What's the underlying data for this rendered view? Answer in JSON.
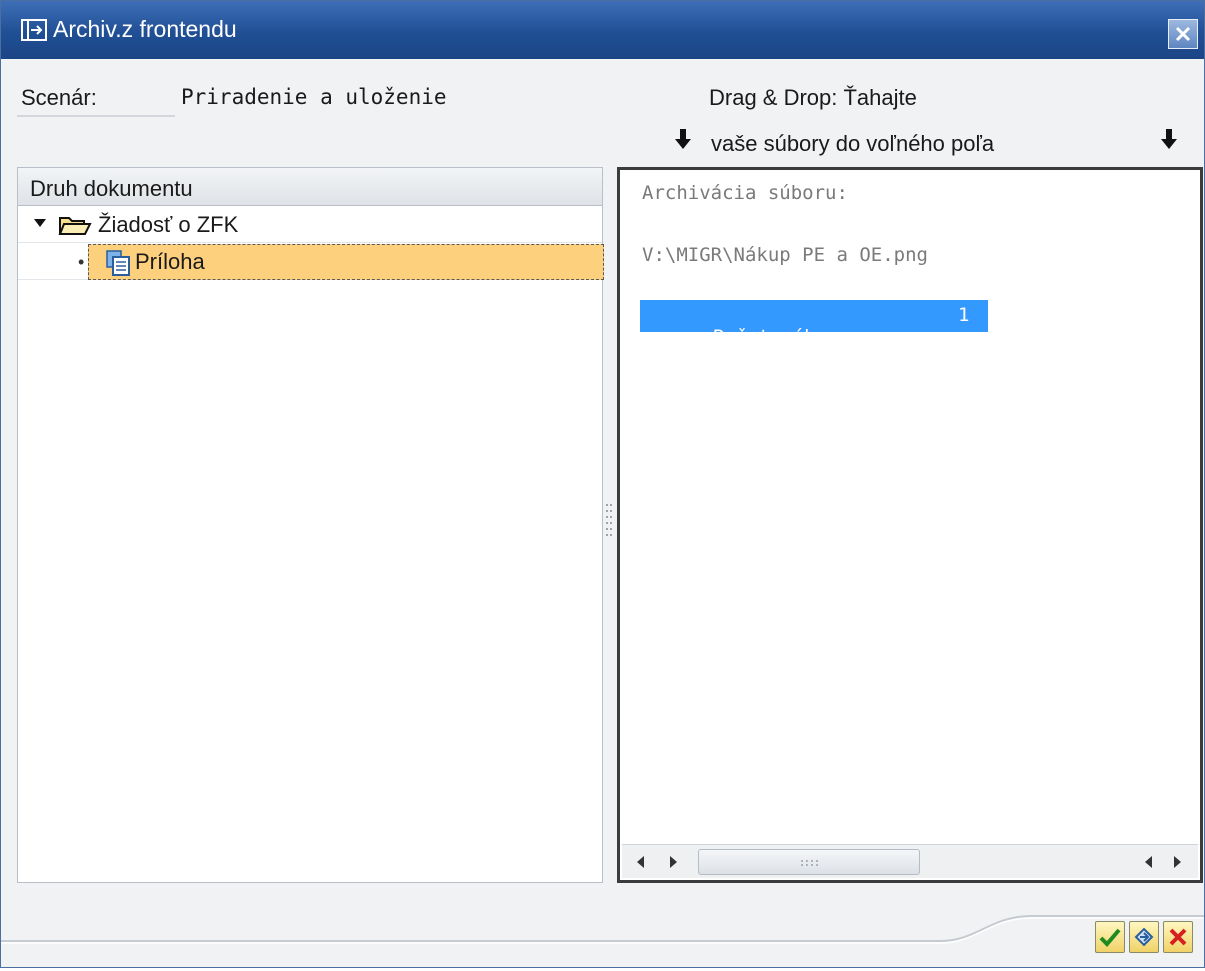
{
  "window": {
    "title": "Archiv.z frontendu",
    "title_icon": "dialog-icon",
    "close_icon": "close-icon"
  },
  "header": {
    "scenario_label": "Scenár:",
    "scenario_value": "Priradenie a uloženie",
    "dnd_line1": "Drag & Drop: Ťahajte",
    "dnd_line2": "vaše súbory do voľného poľa",
    "arrow_icon": "arrow-down-icon"
  },
  "tree": {
    "column_header": "Druh dokumentu",
    "nodes": [
      {
        "label": "Žiadosť o ZFK",
        "icon": "folder-open-icon",
        "expanded": true
      },
      {
        "label": "Príloha",
        "icon": "document-icon",
        "selected": true
      }
    ]
  },
  "log": {
    "line1": "Archivácia súboru:",
    "line2": "V:\\MIGR\\Nákup PE a OE.png",
    "count_label": "Počet súborov:",
    "count_value": "1"
  },
  "footer": {
    "buttons": [
      {
        "name": "confirm",
        "icon": "checkmark-icon"
      },
      {
        "name": "reject",
        "icon": "undo-icon"
      },
      {
        "name": "cancel",
        "icon": "cancel-icon"
      }
    ]
  },
  "colors": {
    "titlebar": "#204f95",
    "selection": "#fdd07e",
    "highlight": "#3399ff"
  }
}
